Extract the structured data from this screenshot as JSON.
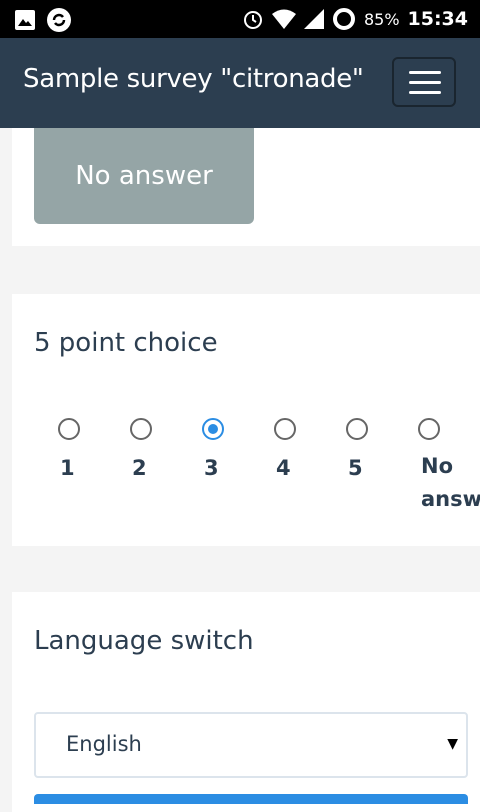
{
  "status_bar": {
    "battery": "85%",
    "time": "15:34",
    "icons": [
      "image-icon",
      "sync-icon",
      "alarm-icon",
      "wifi-icon",
      "signal-icon",
      "battery-icon"
    ]
  },
  "navbar": {
    "title": "Sample survey \"citronade\"",
    "menu_icon": "hamburger-menu-icon"
  },
  "yes_no_question": {
    "no_answer_label": "No answer"
  },
  "five_point_question": {
    "title": "5 point choice",
    "options": [
      {
        "label": "1",
        "checked": false
      },
      {
        "label": "2",
        "checked": false
      },
      {
        "label": "3",
        "checked": true
      },
      {
        "label": "4",
        "checked": false
      },
      {
        "label": "5",
        "checked": false
      },
      {
        "label_line1": "No",
        "label_line2": "answe",
        "checked": false
      }
    ]
  },
  "language_switch": {
    "title": "Language switch",
    "selected": "English"
  },
  "colors": {
    "navbar": "#2c3e50",
    "no_answer_button": "#95a5a6",
    "accent": "#2b8de3"
  }
}
